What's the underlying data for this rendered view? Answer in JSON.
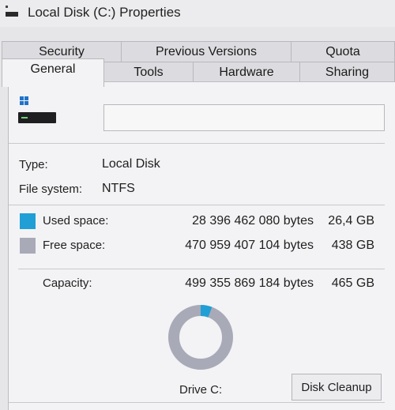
{
  "window": {
    "title": "Local Disk (C:) Properties"
  },
  "tabs": {
    "row1": [
      "Security",
      "Previous Versions",
      "Quota"
    ],
    "row2": [
      "General",
      "Tools",
      "Hardware",
      "Sharing"
    ],
    "active": "General"
  },
  "general": {
    "name_value": "",
    "type_label": "Type:",
    "type_value": "Local Disk",
    "fs_label": "File system:",
    "fs_value": "NTFS",
    "used_label": "Used space:",
    "used_bytes": "28 396 462 080 bytes",
    "used_gb": "26,4 GB",
    "free_label": "Free space:",
    "free_bytes": "470 959 407 104 bytes",
    "free_gb": "438 GB",
    "capacity_label": "Capacity:",
    "capacity_bytes": "499 355 869 184 bytes",
    "capacity_gb": "465 GB",
    "drive_label": "Drive C:",
    "cleanup_label": "Disk Cleanup",
    "used_fraction": 0.057
  },
  "colors": {
    "used": "#1f9fd5",
    "free": "#a8aab8"
  },
  "icons": [
    "drive-title-icon",
    "hard-drive-icon"
  ]
}
